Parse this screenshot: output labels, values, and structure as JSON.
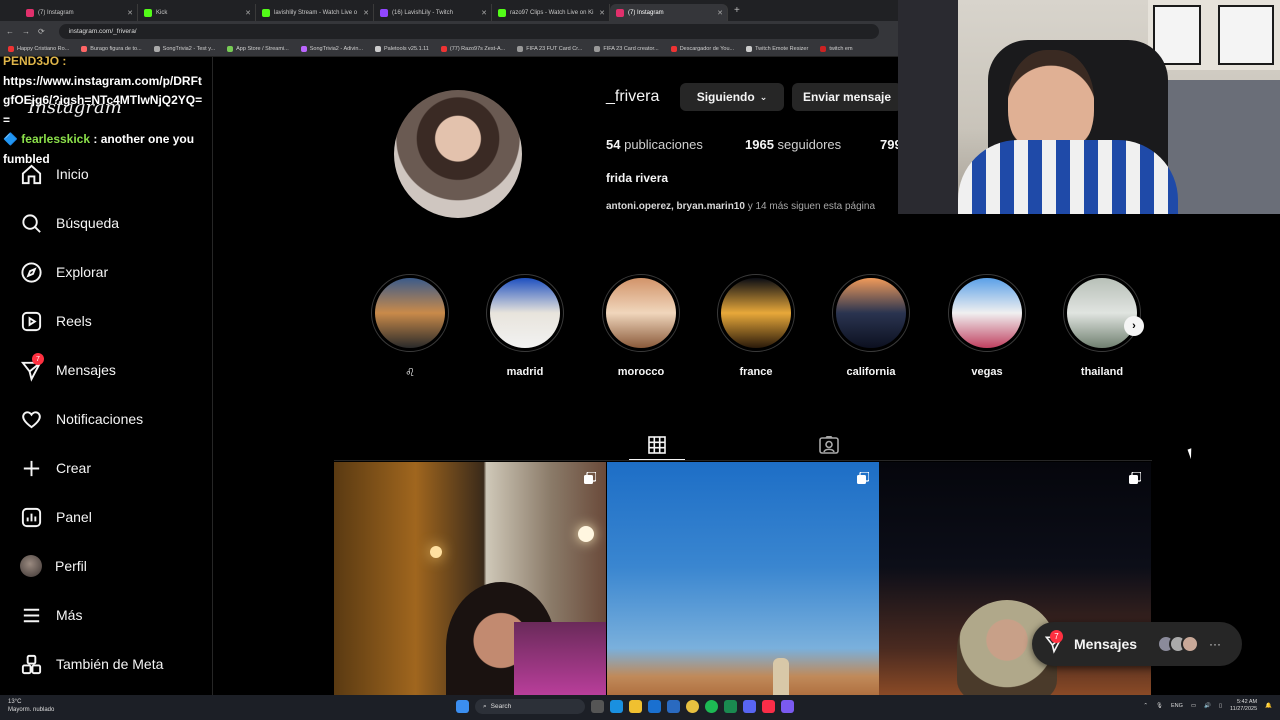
{
  "browser": {
    "tabs": [
      {
        "label": "(7) Instagram",
        "color": "#e1306c"
      },
      {
        "label": "Kick",
        "color": "#53fc18"
      },
      {
        "label": "lavishlily Stream - Watch Live o",
        "color": "#53fc18"
      },
      {
        "label": "(16) LavishLily - Twitch",
        "color": "#9146ff"
      },
      {
        "label": "razo97 Clips - Watch Live on Ki",
        "color": "#53fc18"
      },
      {
        "label": "(7) Instagram",
        "color": "#e1306c"
      }
    ],
    "url": "instagram.com/_frivera/",
    "bookmarks": [
      {
        "label": "Happy Cristiano Ro...",
        "color": "#e33"
      },
      {
        "label": "Burago figura de to...",
        "color": "#f66"
      },
      {
        "label": "SongTrivia2 - Test y...",
        "color": "#aaa"
      },
      {
        "label": "App Store / Streami...",
        "color": "#7c5"
      },
      {
        "label": "SongTrivia2 - Adivin...",
        "color": "#b6f"
      },
      {
        "label": "Paletools v25.1.11",
        "color": "#ccc"
      },
      {
        "label": "(77) Razo97s Zest-A...",
        "color": "#e33"
      },
      {
        "label": "FIFA 23 FUT Card Cr...",
        "color": "#999"
      },
      {
        "label": "FIFA 23 Card creator...",
        "color": "#999"
      },
      {
        "label": "Descargador de You...",
        "color": "#e33"
      },
      {
        "label": "Twitch Emote Resizer",
        "color": "#ccc"
      },
      {
        "label": "twitch em",
        "color": "#c22"
      }
    ]
  },
  "chat": {
    "line1_user": "PEND3JO :",
    "line1_text": "https://www.instagram.com/p/DRFtgfOEjg6/?igsh=NTc4MTlwNjQ2YQ==",
    "line2_user": "fearlesskick",
    "line2_text": ": another one you fumbled"
  },
  "sidebar": {
    "logo": "Instagram",
    "items": [
      {
        "label": "Inicio",
        "icon": "home-icon"
      },
      {
        "label": "Búsqueda",
        "icon": "search-icon"
      },
      {
        "label": "Explorar",
        "icon": "compass-icon"
      },
      {
        "label": "Reels",
        "icon": "reels-icon"
      },
      {
        "label": "Mensajes",
        "icon": "messenger-icon",
        "badge": "7"
      },
      {
        "label": "Notificaciones",
        "icon": "heart-icon"
      },
      {
        "label": "Crear",
        "icon": "plus-icon"
      },
      {
        "label": "Panel",
        "icon": "dashboard-icon"
      },
      {
        "label": "Perfil",
        "icon": "avatar"
      },
      {
        "label": "Más",
        "icon": "menu-icon"
      },
      {
        "label": "También de Meta",
        "icon": "meta-apps-icon"
      }
    ]
  },
  "profile": {
    "username": "_frivera",
    "following_btn": "Siguiendo",
    "message_btn": "Enviar mensaje",
    "posts_count": "54",
    "posts_label": "publicaciones",
    "followers_count": "1965",
    "followers_label": "seguidores",
    "following_count": "799",
    "full_name": "frida rivera",
    "followed_by_names": "antoni.operez, bryan.marin10",
    "followed_by_rest": "y 14 más siguen esta página"
  },
  "highlights": [
    {
      "label": "♌︎",
      "colors": [
        "#3b5b8a",
        "#c98a4a",
        "#2a2a2a"
      ]
    },
    {
      "label": "madrid",
      "colors": [
        "#1e50c0",
        "#e8e4dc",
        "#f2f2f2"
      ]
    },
    {
      "label": "morocco",
      "colors": [
        "#d2946a",
        "#f0d6bc",
        "#8a5a3a"
      ]
    },
    {
      "label": "france",
      "colors": [
        "#0b0d14",
        "#e8a83a",
        "#2a1a0a"
      ]
    },
    {
      "label": "california",
      "colors": [
        "#f09a5a",
        "#2a3450",
        "#0c1020"
      ]
    },
    {
      "label": "vegas",
      "colors": [
        "#5aa0e8",
        "#f0f0f0",
        "#c04060"
      ]
    },
    {
      "label": "thailand",
      "colors": [
        "#b8c0b8",
        "#e0e4e0",
        "#708070"
      ]
    }
  ],
  "messages_pill": {
    "label": "Mensajes",
    "badge": "7"
  },
  "taskbar": {
    "weather_temp": "13°C",
    "weather_desc": "Mayorm. nublado",
    "search": "Search",
    "lang": "ENG",
    "time": "5:42 AM",
    "date": "11/27/2025"
  }
}
